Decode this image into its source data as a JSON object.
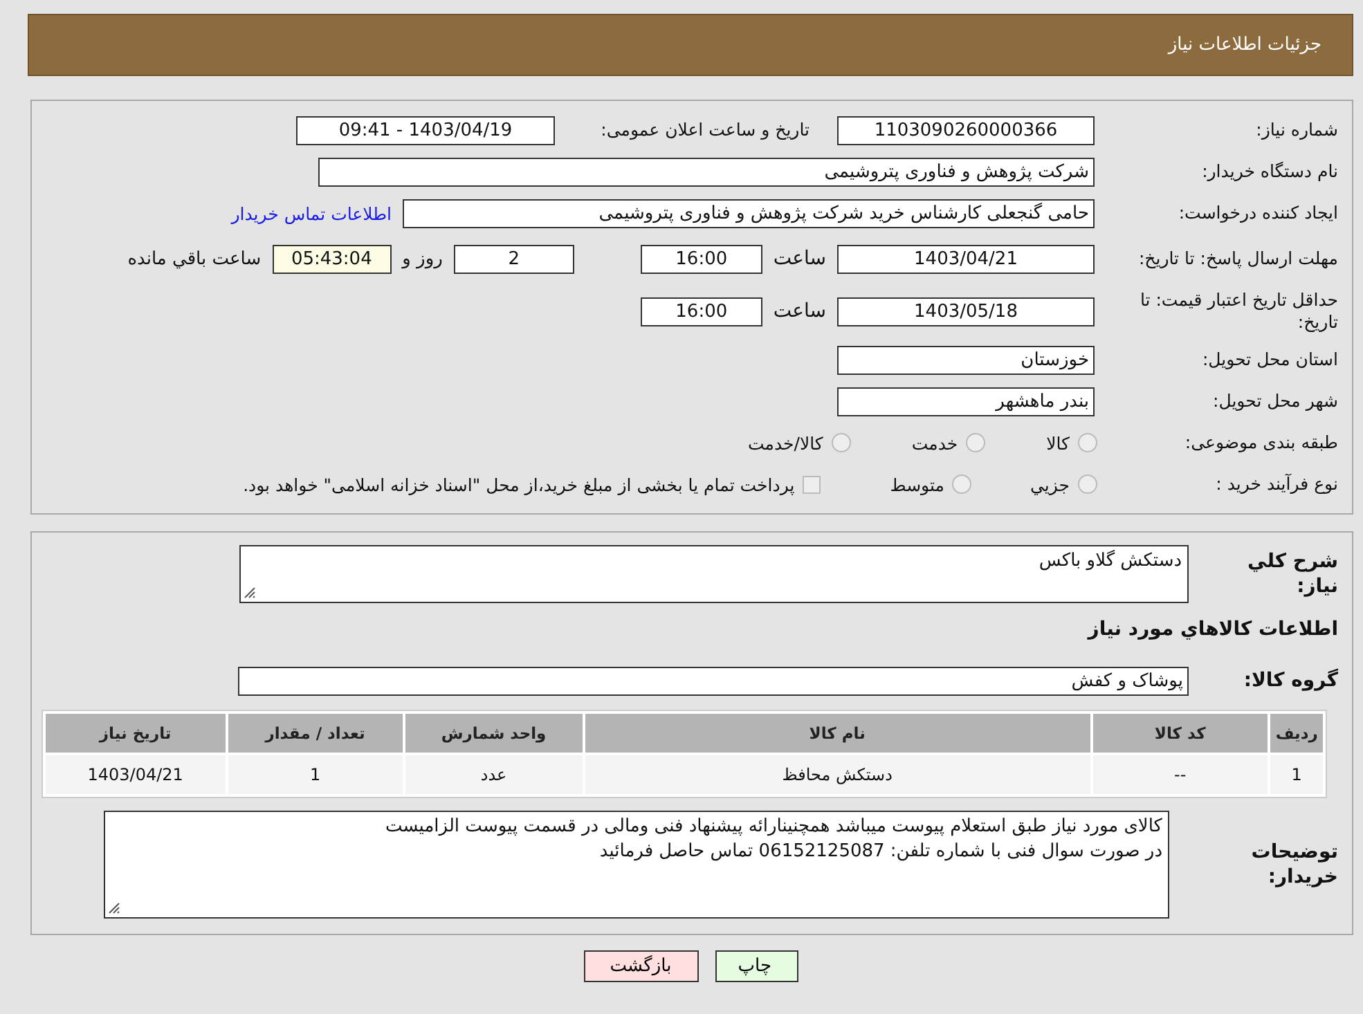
{
  "header": {
    "title": "جزئیات اطلاعات نیاز"
  },
  "need_number": {
    "label": "شماره نیاز:",
    "value": "1103090260000366"
  },
  "announce": {
    "label": "تاریخ و ساعت اعلان عمومی:",
    "value": "1403/04/19 - 09:41"
  },
  "buyer_org": {
    "label": "نام دستگاه خریدار:",
    "value": "شرکت پژوهش و فناوری پتروشیمی"
  },
  "creator": {
    "label": "ایجاد کننده درخواست:",
    "value": "حامی گنجعلی کارشناس خرید شرکت پژوهش و فناوری پتروشیمی",
    "link": "اطلاعات تماس خریدار"
  },
  "reply_deadline": {
    "label": "مهلت ارسال پاسخ: تا تاریخ:",
    "date": "1403/04/21",
    "time_label": "ساعت",
    "time": "16:00",
    "days": "2",
    "days_label": "روز و",
    "remaining": "05:43:04",
    "remaining_label": "ساعت باقي مانده"
  },
  "price_validity": {
    "label": "حداقل تاریخ اعتبار قیمت: تا تاریخ:",
    "date": "1403/05/18",
    "time_label": "ساعت",
    "time": "16:00"
  },
  "province": {
    "label": "استان محل تحویل:",
    "value": "خوزستان"
  },
  "city": {
    "label": "شهر محل تحویل:",
    "value": "بندر ماهشهر"
  },
  "category": {
    "label": "طبقه بندی موضوعی:",
    "options": [
      {
        "label": "کالا",
        "selected": false
      },
      {
        "label": "خدمت",
        "selected": false
      },
      {
        "label": "کالا/خدمت",
        "selected": false
      }
    ]
  },
  "purchase_type": {
    "label": "نوع فرآیند خرید :",
    "options": [
      {
        "label": "جزيي",
        "selected": false
      },
      {
        "label": "متوسط",
        "selected": false
      }
    ],
    "treasury": {
      "label": "پرداخت تمام یا بخشی از مبلغ خرید،از محل \"اسناد خزانه اسلامی\" خواهد بود.",
      "checked": false
    }
  },
  "summary": {
    "label": "شرح کلي نیاز:",
    "value": "دستکش گلاو باکس"
  },
  "items_title": "اطلاعات کالاهاي مورد نیاز",
  "goods_group": {
    "label": "گروه کالا:",
    "value": "پوشاک و کفش"
  },
  "table": {
    "columns": [
      "ردیف",
      "کد کالا",
      "نام کالا",
      "واحد شمارش",
      "تعداد / مقدار",
      "تاریخ نیاز"
    ],
    "rows": [
      [
        "1",
        "--",
        "دستکش محافظ",
        "عدد",
        "1",
        "1403/04/21"
      ]
    ]
  },
  "buyer_notes": {
    "label": "توضیحات خریدار:",
    "lines": [
      "کالای مورد نیاز طبق استعلام پیوست میباشد همچنینارائه پیشنهاد فنی ومالی در قسمت پیوست الزامیست",
      "در صورت سوال فنی با شماره تلفن: 06152125087 تماس حاصل فرمائید"
    ]
  },
  "buttons": [
    {
      "label": "چاپ",
      "kind": "print"
    },
    {
      "label": "بازگشت",
      "kind": "back"
    }
  ]
}
